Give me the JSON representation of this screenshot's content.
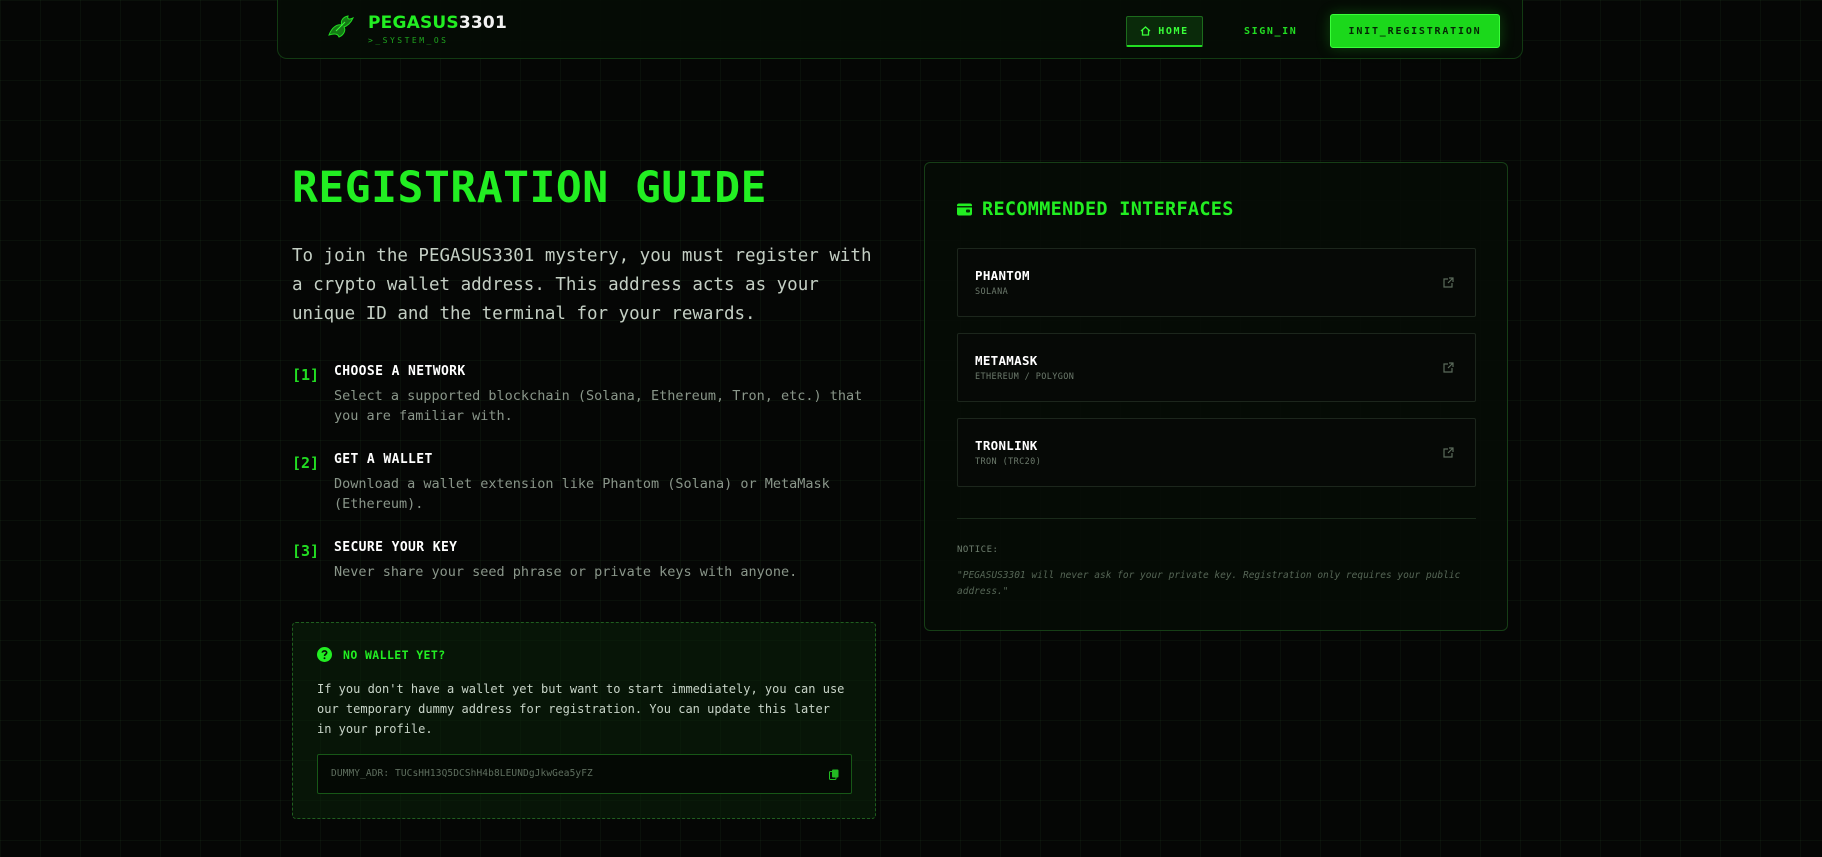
{
  "nav": {
    "brand_part1": "PEGASUS",
    "brand_part2": "3301",
    "brand_sub": ">_SYSTEM_OS",
    "home": "HOME",
    "sign_in": "SIGN_IN",
    "register": "INIT_REGISTRATION"
  },
  "guide": {
    "title": "REGISTRATION GUIDE",
    "intro": "To join the PEGASUS3301 mystery, you must register with a crypto wallet address. This address acts as your unique ID and the terminal for your rewards.",
    "steps": [
      {
        "num": "[1]",
        "title": "CHOOSE A NETWORK",
        "desc": "Select a supported blockchain (Solana, Ethereum, Tron, etc.) that you are familiar with."
      },
      {
        "num": "[2]",
        "title": "GET A WALLET",
        "desc": "Download a wallet extension like Phantom (Solana) or MetaMask (Ethereum)."
      },
      {
        "num": "[3]",
        "title": "SECURE YOUR KEY",
        "desc": "Never share your seed phrase or private keys with anyone."
      }
    ]
  },
  "no_wallet": {
    "title": "NO WALLET YET?",
    "text": "If you don't have a wallet yet but want to start immediately, you can use our temporary dummy address for registration. You can update this later in your profile.",
    "dummy": "DUMMY_ADR: TUCsHH13Q5DCShH4b8LEUNDgJkwGea5yFZ"
  },
  "interfaces": {
    "title": "RECOMMENDED INTERFACES",
    "items": [
      {
        "name": "PHANTOM",
        "network": "SOLANA"
      },
      {
        "name": "METAMASK",
        "network": "ETHEREUM / POLYGON"
      },
      {
        "name": "TRONLINK",
        "network": "TRON (TRC20)"
      }
    ],
    "notice_label": "NOTICE:",
    "notice_text": "\"PEGASUS3301 will never ask for your private key. Registration only requires your public address.\""
  },
  "colors": {
    "accent": "#22ee22",
    "background": "#050605"
  },
  "icons": {
    "logo": "pegasus-logo-icon",
    "home": "home-icon",
    "help": "question-circle-icon",
    "copy": "copy-icon",
    "wallet": "wallet-icon",
    "external": "external-link-icon"
  }
}
